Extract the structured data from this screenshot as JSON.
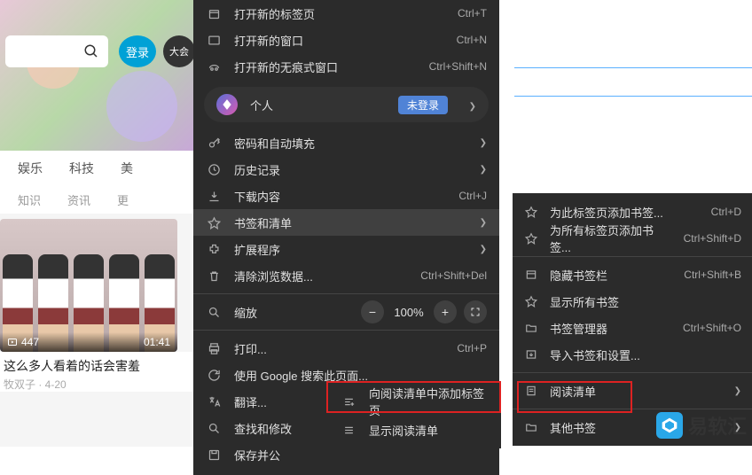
{
  "site": {
    "login_label": "登录",
    "vip_label": "大会",
    "tabs_primary": [
      "娱乐",
      "科技",
      "美"
    ],
    "tabs_secondary": [
      "知识",
      "资讯",
      "更"
    ],
    "video": {
      "play_count": "447",
      "duration": "01:41",
      "title": "这么多人看着的话会害羞",
      "meta": "牧双子 · 4-20"
    }
  },
  "menu": {
    "new_tab": "打开新的标签页",
    "new_tab_key": "Ctrl+T",
    "new_window": "打开新的窗口",
    "new_window_key": "Ctrl+N",
    "incognito": "打开新的无痕式窗口",
    "incognito_key": "Ctrl+Shift+N",
    "profile_label": "个人",
    "not_logged": "未登录",
    "passwords": "密码和自动填充",
    "history": "历史记录",
    "downloads": "下载内容",
    "downloads_key": "Ctrl+J",
    "bookmarks": "书签和清单",
    "extensions": "扩展程序",
    "clear_data": "清除浏览数据...",
    "clear_data_key": "Ctrl+Shift+Del",
    "zoom_label": "缩放",
    "zoom_pct": "100%",
    "print": "打印...",
    "print_key": "Ctrl+P",
    "google_search": "使用 Google 搜索此页面...",
    "translate": "翻译...",
    "find_edit": "查找和修改",
    "save_share": "保存并公"
  },
  "submenu1": {
    "add_reading": "向阅读清单中添加标签页",
    "show_reading": "显示阅读清单"
  },
  "submenu2": {
    "bookmark_this": "为此标签页添加书签...",
    "bookmark_this_key": "Ctrl+D",
    "bookmark_all": "为所有标签页添加书签...",
    "bookmark_all_key": "Ctrl+Shift+D",
    "hide_bar": "隐藏书签栏",
    "hide_bar_key": "Ctrl+Shift+B",
    "show_all": "显示所有书签",
    "manager": "书签管理器",
    "manager_key": "Ctrl+Shift+O",
    "import": "导入书签和设置...",
    "reading_list": "阅读清单",
    "other": "其他书签"
  },
  "brand": "易软汇"
}
